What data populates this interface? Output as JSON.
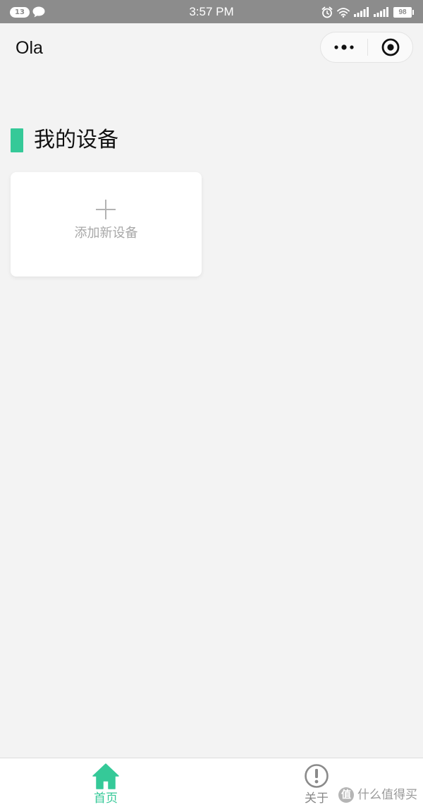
{
  "status_bar": {
    "notification_count": "13",
    "time": "3:57 PM",
    "battery": "98",
    "icons": [
      "chat-icon",
      "alarm-icon",
      "wifi-icon",
      "signal-icon",
      "signal-icon",
      "battery-icon"
    ]
  },
  "nav": {
    "title": "Ola",
    "menu_icon": "more-dots-icon",
    "close_icon": "target-close-icon"
  },
  "section": {
    "title": "我的设备"
  },
  "add_device": {
    "icon": "plus-icon",
    "label": "添加新设备"
  },
  "tab_bar": {
    "tabs": [
      {
        "label": "首页",
        "icon": "home-icon",
        "active": true
      },
      {
        "label": "关于",
        "icon": "info-circle-icon",
        "active": false
      }
    ]
  },
  "watermark": {
    "logo_text": "值",
    "text": "什么值得买"
  },
  "colors": {
    "accent": "#35c998",
    "background": "#f3f3f3",
    "status_bar": "#8c8c8c"
  }
}
